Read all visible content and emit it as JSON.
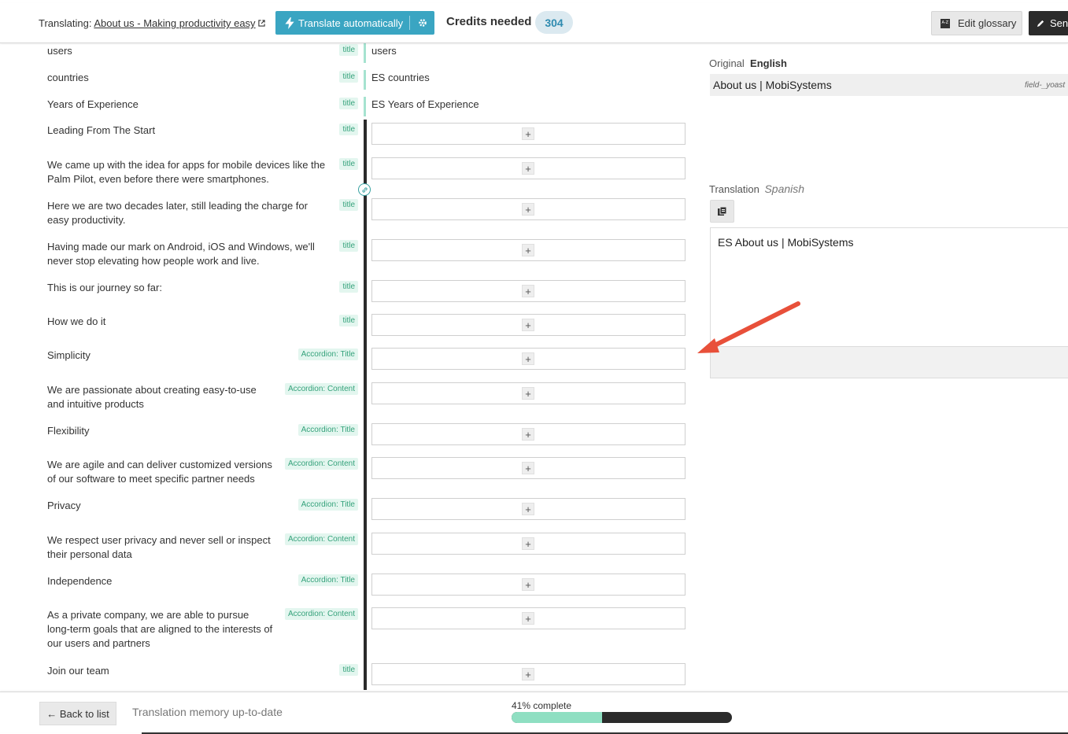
{
  "header": {
    "translating_label": "Translating:",
    "page_link": "About us - Making productivity easy",
    "translate_auto_label": "Translate automatically",
    "credits_label": "Credits needed",
    "credits_value": "304",
    "edit_glossary_label": "Edit glossary",
    "send_label": "Send"
  },
  "rows": [
    {
      "source": "users",
      "tag": "title",
      "target": "users",
      "translated": true
    },
    {
      "source": "countries",
      "tag": "title",
      "target": "ES countries",
      "translated": true
    },
    {
      "source": "Years of Experience",
      "tag": "title",
      "target": "ES Years of Experience",
      "translated": true
    },
    {
      "source": "Leading From The Start",
      "tag": "title",
      "target": "",
      "translated": false
    },
    {
      "source": "We came up with the idea for apps for mobile devices like the Palm Pilot, even before there were smartphones.",
      "tag": "title",
      "target": "",
      "translated": false
    },
    {
      "source": "Here we are two decades later, still leading the charge for easy productivity.",
      "tag": "title",
      "target": "",
      "translated": false
    },
    {
      "source": "Having made our mark on Android, iOS and Windows, we'll never stop elevating how people work and live.",
      "tag": "title",
      "target": "",
      "translated": false
    },
    {
      "source": "This is our journey so far:",
      "tag": "title",
      "target": "",
      "translated": false
    },
    {
      "source": "How we do it",
      "tag": "title",
      "target": "",
      "translated": false
    },
    {
      "source": "Simplicity",
      "tag": "Accordion: Title",
      "target": "",
      "translated": false
    },
    {
      "source": "We are passionate about creating easy-to-use and intuitive products",
      "tag": "Accordion: Content",
      "target": "",
      "translated": false
    },
    {
      "source": "Flexibility",
      "tag": "Accordion: Title",
      "target": "",
      "translated": false
    },
    {
      "source": "We are agile and can deliver customized versions of our software to meet specific partner needs",
      "tag": "Accordion: Content",
      "target": "",
      "translated": false
    },
    {
      "source": "Privacy",
      "tag": "Accordion: Title",
      "target": "",
      "translated": false
    },
    {
      "source": "We respect user privacy and never sell or inspect their personal data",
      "tag": "Accordion: Content",
      "target": "",
      "translated": false
    },
    {
      "source": "Independence",
      "tag": "Accordion: Title",
      "target": "",
      "translated": false
    },
    {
      "source": "As a private company, we are able to pursue long-term goals that are aligned to the interests of our users and partners",
      "tag": "Accordion: Content",
      "target": "",
      "translated": false
    },
    {
      "source": "Join our team",
      "tag": "title",
      "target": "",
      "translated": false
    }
  ],
  "side": {
    "original_label": "Original",
    "original_lang": "English",
    "original_text": "About us | MobiSystems",
    "original_field": "field-_yoast",
    "translation_label": "Translation",
    "translation_lang": "Spanish",
    "translation_text": "ES About us | MobiSystems"
  },
  "footer": {
    "back_label": "← Back to list",
    "tm_status": "Translation memory up-to-date",
    "progress_label": "41% complete",
    "progress_fraction": 0.41
  },
  "colors": {
    "accent": "#3aa5c2",
    "tag_bg": "#e3f6ef",
    "tag_fg": "#35a27b",
    "arrow": "#e8503a",
    "progress_fill": "#8fdfc2"
  }
}
